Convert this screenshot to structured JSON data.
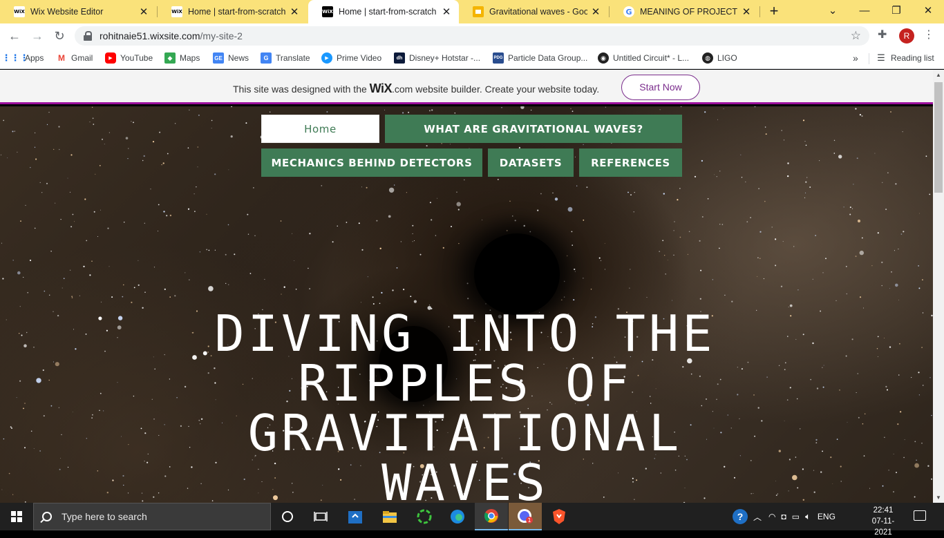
{
  "browser": {
    "tabs": [
      {
        "title": "Wix Website Editor",
        "favicon": "wix-icon"
      },
      {
        "title": "Home | start-from-scratch",
        "favicon": "wix-icon"
      },
      {
        "title": "Home | start-from-scratch",
        "favicon": "wix-icon",
        "active": true
      },
      {
        "title": "Gravitational waves - Google",
        "favicon": "google-slides-icon"
      },
      {
        "title": "MEANING OF PROJECT MED",
        "favicon": "google-icon"
      }
    ],
    "url_host": "rohitnaie51.wixsite.com",
    "url_path": "/my-site-2",
    "profile_initial": "R",
    "bookmarks": [
      {
        "label": "Apps",
        "icon": "apps-grid-icon"
      },
      {
        "label": "Gmail",
        "icon": "gmail-icon"
      },
      {
        "label": "YouTube",
        "icon": "youtube-icon"
      },
      {
        "label": "Maps",
        "icon": "maps-icon"
      },
      {
        "label": "News",
        "icon": "google-news-icon"
      },
      {
        "label": "Translate",
        "icon": "google-translate-icon"
      },
      {
        "label": "Prime Video",
        "icon": "prime-video-icon"
      },
      {
        "label": "Disney+ Hotstar -...",
        "icon": "hotstar-icon"
      },
      {
        "label": "Particle Data Group...",
        "icon": "pdg-icon"
      },
      {
        "label": "Untitled Circuit* - L...",
        "icon": "circuit-icon"
      },
      {
        "label": "LIGO",
        "icon": "ligo-icon"
      }
    ],
    "bookmarks_more": "»",
    "reading_list": "Reading list"
  },
  "wix_banner": {
    "text_before": "This site was designed with the",
    "logo": "WiX",
    "text_after": ".com website builder. Create your website today.",
    "cta": "Start Now"
  },
  "site": {
    "nav": {
      "home": "Home",
      "what_are": "WHAT ARE GRAVITATIONAL WAVES?",
      "mechanics": "MECHANICS BEHIND DETECTORS",
      "datasets": "DATASETS",
      "references": "REFERENCES"
    },
    "hero_title_lines": [
      "DIVING INTO THE",
      "RIPPLES OF",
      "GRAVITATIONAL",
      "WAVES"
    ]
  },
  "taskbar": {
    "search_placeholder": "Type here to search",
    "language": "ENG",
    "time": "22:41",
    "date": "07-11-2021"
  },
  "colors": {
    "tabstrip": "#fae27a",
    "nav_green": "#3f7b55",
    "wix_purple": "#7a2c8c"
  }
}
